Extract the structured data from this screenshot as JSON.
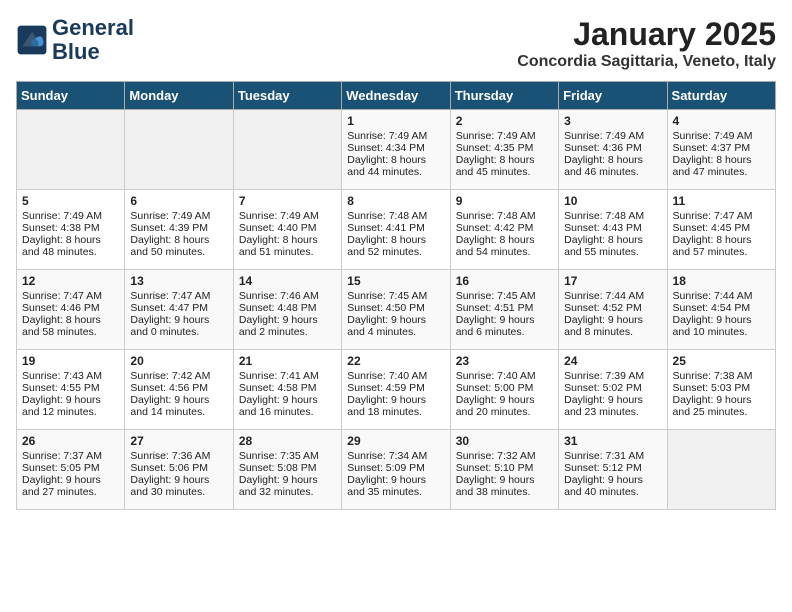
{
  "header": {
    "logo_line1": "General",
    "logo_line2": "Blue",
    "month_year": "January 2025",
    "location": "Concordia Sagittaria, Veneto, Italy"
  },
  "days_of_week": [
    "Sunday",
    "Monday",
    "Tuesday",
    "Wednesday",
    "Thursday",
    "Friday",
    "Saturday"
  ],
  "weeks": [
    [
      {
        "day": "",
        "empty": true
      },
      {
        "day": "",
        "empty": true
      },
      {
        "day": "",
        "empty": true
      },
      {
        "day": "1",
        "sunrise": "Sunrise: 7:49 AM",
        "sunset": "Sunset: 4:34 PM",
        "daylight": "Daylight: 8 hours and 44 minutes."
      },
      {
        "day": "2",
        "sunrise": "Sunrise: 7:49 AM",
        "sunset": "Sunset: 4:35 PM",
        "daylight": "Daylight: 8 hours and 45 minutes."
      },
      {
        "day": "3",
        "sunrise": "Sunrise: 7:49 AM",
        "sunset": "Sunset: 4:36 PM",
        "daylight": "Daylight: 8 hours and 46 minutes."
      },
      {
        "day": "4",
        "sunrise": "Sunrise: 7:49 AM",
        "sunset": "Sunset: 4:37 PM",
        "daylight": "Daylight: 8 hours and 47 minutes."
      }
    ],
    [
      {
        "day": "5",
        "sunrise": "Sunrise: 7:49 AM",
        "sunset": "Sunset: 4:38 PM",
        "daylight": "Daylight: 8 hours and 48 minutes."
      },
      {
        "day": "6",
        "sunrise": "Sunrise: 7:49 AM",
        "sunset": "Sunset: 4:39 PM",
        "daylight": "Daylight: 8 hours and 50 minutes."
      },
      {
        "day": "7",
        "sunrise": "Sunrise: 7:49 AM",
        "sunset": "Sunset: 4:40 PM",
        "daylight": "Daylight: 8 hours and 51 minutes."
      },
      {
        "day": "8",
        "sunrise": "Sunrise: 7:48 AM",
        "sunset": "Sunset: 4:41 PM",
        "daylight": "Daylight: 8 hours and 52 minutes."
      },
      {
        "day": "9",
        "sunrise": "Sunrise: 7:48 AM",
        "sunset": "Sunset: 4:42 PM",
        "daylight": "Daylight: 8 hours and 54 minutes."
      },
      {
        "day": "10",
        "sunrise": "Sunrise: 7:48 AM",
        "sunset": "Sunset: 4:43 PM",
        "daylight": "Daylight: 8 hours and 55 minutes."
      },
      {
        "day": "11",
        "sunrise": "Sunrise: 7:47 AM",
        "sunset": "Sunset: 4:45 PM",
        "daylight": "Daylight: 8 hours and 57 minutes."
      }
    ],
    [
      {
        "day": "12",
        "sunrise": "Sunrise: 7:47 AM",
        "sunset": "Sunset: 4:46 PM",
        "daylight": "Daylight: 8 hours and 58 minutes."
      },
      {
        "day": "13",
        "sunrise": "Sunrise: 7:47 AM",
        "sunset": "Sunset: 4:47 PM",
        "daylight": "Daylight: 9 hours and 0 minutes."
      },
      {
        "day": "14",
        "sunrise": "Sunrise: 7:46 AM",
        "sunset": "Sunset: 4:48 PM",
        "daylight": "Daylight: 9 hours and 2 minutes."
      },
      {
        "day": "15",
        "sunrise": "Sunrise: 7:45 AM",
        "sunset": "Sunset: 4:50 PM",
        "daylight": "Daylight: 9 hours and 4 minutes."
      },
      {
        "day": "16",
        "sunrise": "Sunrise: 7:45 AM",
        "sunset": "Sunset: 4:51 PM",
        "daylight": "Daylight: 9 hours and 6 minutes."
      },
      {
        "day": "17",
        "sunrise": "Sunrise: 7:44 AM",
        "sunset": "Sunset: 4:52 PM",
        "daylight": "Daylight: 9 hours and 8 minutes."
      },
      {
        "day": "18",
        "sunrise": "Sunrise: 7:44 AM",
        "sunset": "Sunset: 4:54 PM",
        "daylight": "Daylight: 9 hours and 10 minutes."
      }
    ],
    [
      {
        "day": "19",
        "sunrise": "Sunrise: 7:43 AM",
        "sunset": "Sunset: 4:55 PM",
        "daylight": "Daylight: 9 hours and 12 minutes."
      },
      {
        "day": "20",
        "sunrise": "Sunrise: 7:42 AM",
        "sunset": "Sunset: 4:56 PM",
        "daylight": "Daylight: 9 hours and 14 minutes."
      },
      {
        "day": "21",
        "sunrise": "Sunrise: 7:41 AM",
        "sunset": "Sunset: 4:58 PM",
        "daylight": "Daylight: 9 hours and 16 minutes."
      },
      {
        "day": "22",
        "sunrise": "Sunrise: 7:40 AM",
        "sunset": "Sunset: 4:59 PM",
        "daylight": "Daylight: 9 hours and 18 minutes."
      },
      {
        "day": "23",
        "sunrise": "Sunrise: 7:40 AM",
        "sunset": "Sunset: 5:00 PM",
        "daylight": "Daylight: 9 hours and 20 minutes."
      },
      {
        "day": "24",
        "sunrise": "Sunrise: 7:39 AM",
        "sunset": "Sunset: 5:02 PM",
        "daylight": "Daylight: 9 hours and 23 minutes."
      },
      {
        "day": "25",
        "sunrise": "Sunrise: 7:38 AM",
        "sunset": "Sunset: 5:03 PM",
        "daylight": "Daylight: 9 hours and 25 minutes."
      }
    ],
    [
      {
        "day": "26",
        "sunrise": "Sunrise: 7:37 AM",
        "sunset": "Sunset: 5:05 PM",
        "daylight": "Daylight: 9 hours and 27 minutes."
      },
      {
        "day": "27",
        "sunrise": "Sunrise: 7:36 AM",
        "sunset": "Sunset: 5:06 PM",
        "daylight": "Daylight: 9 hours and 30 minutes."
      },
      {
        "day": "28",
        "sunrise": "Sunrise: 7:35 AM",
        "sunset": "Sunset: 5:08 PM",
        "daylight": "Daylight: 9 hours and 32 minutes."
      },
      {
        "day": "29",
        "sunrise": "Sunrise: 7:34 AM",
        "sunset": "Sunset: 5:09 PM",
        "daylight": "Daylight: 9 hours and 35 minutes."
      },
      {
        "day": "30",
        "sunrise": "Sunrise: 7:32 AM",
        "sunset": "Sunset: 5:10 PM",
        "daylight": "Daylight: 9 hours and 38 minutes."
      },
      {
        "day": "31",
        "sunrise": "Sunrise: 7:31 AM",
        "sunset": "Sunset: 5:12 PM",
        "daylight": "Daylight: 9 hours and 40 minutes."
      },
      {
        "day": "",
        "empty": true
      }
    ]
  ]
}
